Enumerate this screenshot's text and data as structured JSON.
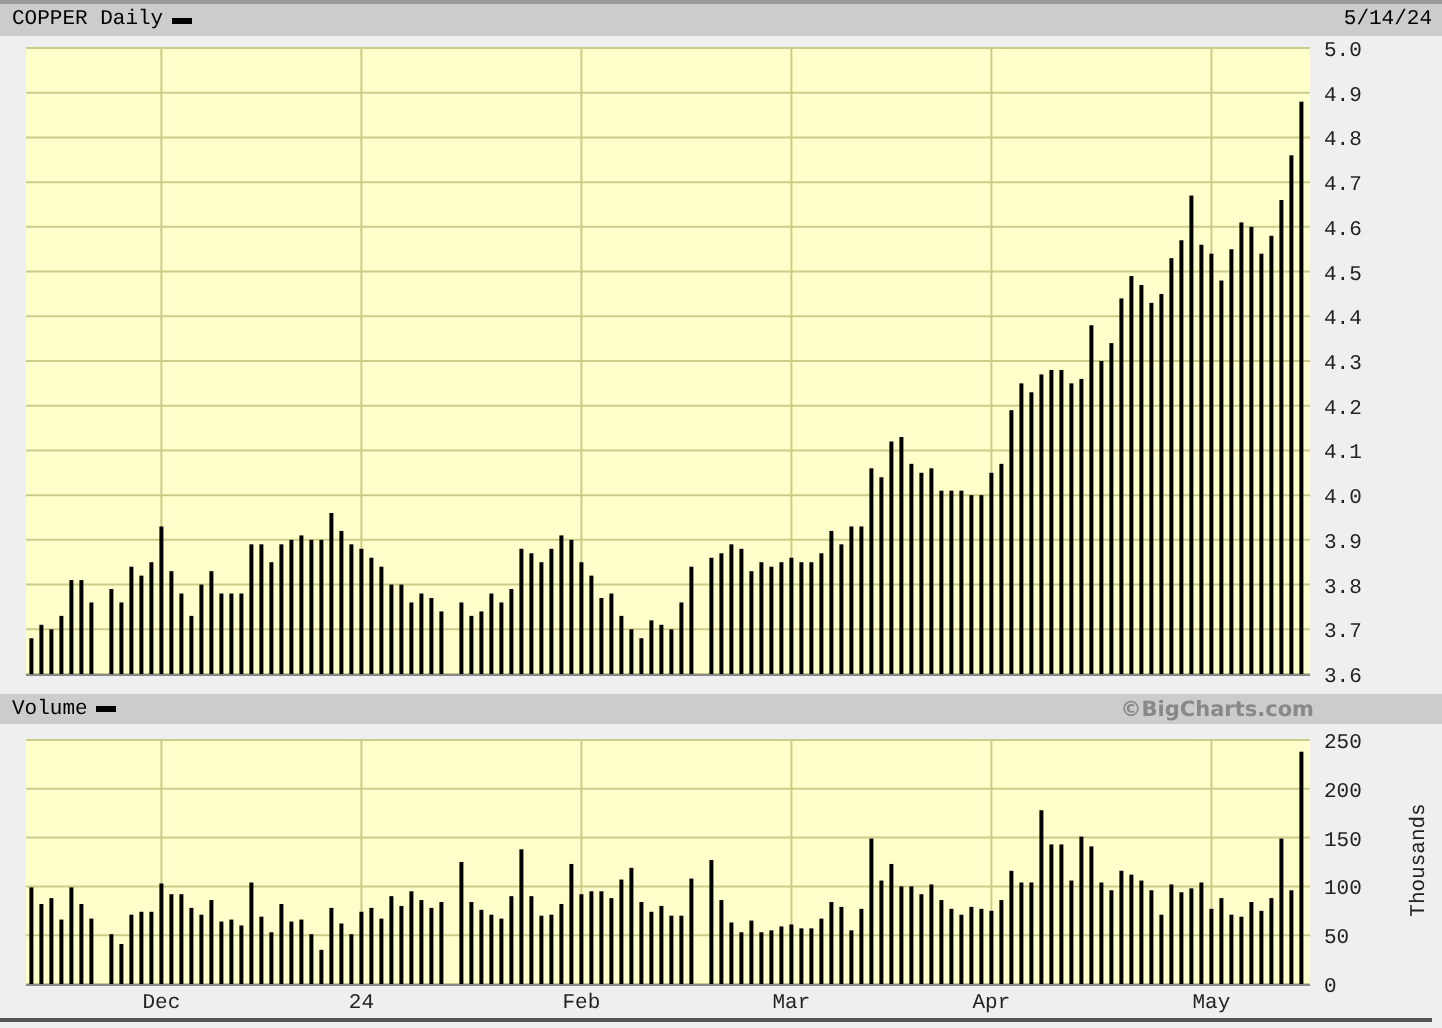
{
  "price_panel": {
    "title": "COPPER Daily",
    "date": "5/14/24",
    "chart_data": {
      "type": "bar",
      "grid": true,
      "ylim": [
        3.6,
        5.0
      ],
      "yticks": [
        {
          "value": 3.6,
          "label": "3.6"
        },
        {
          "value": 3.7,
          "label": "3.7"
        },
        {
          "value": 3.8,
          "label": "3.8"
        },
        {
          "value": 3.9,
          "label": "3.9"
        },
        {
          "value": 4.0,
          "label": "4.0"
        },
        {
          "value": 4.1,
          "label": "4.1"
        },
        {
          "value": 4.2,
          "label": "4.2"
        },
        {
          "value": 4.3,
          "label": "4.3"
        },
        {
          "value": 4.4,
          "label": "4.4"
        },
        {
          "value": 4.5,
          "label": "4.5"
        },
        {
          "value": 4.6,
          "label": "4.6"
        },
        {
          "value": 4.7,
          "label": "4.7"
        },
        {
          "value": 4.8,
          "label": "4.8"
        },
        {
          "value": 4.9,
          "label": "4.9"
        },
        {
          "value": 5.0,
          "label": "5.0"
        }
      ],
      "values": [
        3.68,
        3.71,
        3.7,
        3.73,
        3.81,
        3.81,
        3.76,
        null,
        3.79,
        3.76,
        3.84,
        3.82,
        3.85,
        3.93,
        3.83,
        3.78,
        3.73,
        3.8,
        3.83,
        3.78,
        3.78,
        3.78,
        3.89,
        3.89,
        3.85,
        3.89,
        3.9,
        3.91,
        3.9,
        3.9,
        3.96,
        3.92,
        3.89,
        3.88,
        3.86,
        3.84,
        3.8,
        3.8,
        3.76,
        3.78,
        3.77,
        3.74,
        null,
        3.76,
        3.73,
        3.74,
        3.78,
        3.76,
        3.79,
        3.88,
        3.87,
        3.85,
        3.88,
        3.91,
        3.9,
        3.85,
        3.82,
        3.77,
        3.78,
        3.73,
        3.7,
        3.68,
        3.72,
        3.71,
        3.7,
        3.76,
        3.84,
        null,
        3.86,
        3.87,
        3.89,
        3.88,
        3.83,
        3.85,
        3.84,
        3.85,
        3.86,
        3.85,
        3.85,
        3.87,
        3.92,
        3.89,
        3.93,
        3.93,
        4.06,
        4.04,
        4.12,
        4.13,
        4.07,
        4.05,
        4.06,
        4.01,
        4.01,
        4.01,
        4.0,
        4.0,
        4.05,
        4.07,
        4.19,
        4.25,
        4.23,
        4.27,
        4.28,
        4.28,
        4.25,
        4.26,
        4.38,
        4.3,
        4.34,
        4.44,
        4.49,
        4.47,
        4.43,
        4.45,
        4.53,
        4.57,
        4.67,
        4.56,
        4.54,
        4.48,
        4.55,
        4.61,
        4.6,
        4.54,
        4.58,
        4.66,
        4.76,
        4.88
      ]
    }
  },
  "volume_panel": {
    "title": "Volume",
    "credit": "©BigCharts.com",
    "chart_data": {
      "type": "bar",
      "grid": true,
      "ylabel": "Thousands",
      "ylim": [
        0,
        250
      ],
      "yticks": [
        0,
        50,
        100,
        150,
        200,
        250
      ],
      "categories": [
        null,
        null,
        null,
        null,
        null,
        null,
        null,
        null,
        null,
        null,
        null,
        null,
        null,
        "Dec",
        null,
        null,
        null,
        null,
        null,
        null,
        null,
        null,
        null,
        null,
        null,
        null,
        null,
        null,
        null,
        null,
        null,
        null,
        null,
        "24",
        null,
        null,
        null,
        null,
        null,
        null,
        null,
        null,
        null,
        null,
        null,
        null,
        null,
        null,
        null,
        null,
        null,
        null,
        null,
        null,
        null,
        "Feb",
        null,
        null,
        null,
        null,
        null,
        null,
        null,
        null,
        null,
        null,
        null,
        null,
        null,
        null,
        null,
        null,
        null,
        null,
        null,
        null,
        "Mar",
        null,
        null,
        null,
        null,
        null,
        null,
        null,
        null,
        null,
        null,
        null,
        null,
        null,
        null,
        null,
        null,
        null,
        null,
        null,
        "Apr",
        null,
        null,
        null,
        null,
        null,
        null,
        null,
        null,
        null,
        null,
        null,
        null,
        null,
        null,
        null,
        null,
        null,
        null,
        null,
        null,
        null,
        "May",
        null,
        null,
        null,
        null,
        null,
        null,
        null,
        null,
        null
      ],
      "values": [
        99,
        82,
        88,
        66,
        99,
        82,
        67,
        null,
        51,
        41,
        71,
        74,
        74,
        103,
        92,
        92,
        78,
        71,
        86,
        64,
        66,
        60,
        104,
        69,
        53,
        82,
        64,
        66,
        51,
        35,
        78,
        62,
        51,
        74,
        78,
        67,
        90,
        80,
        95,
        86,
        78,
        84,
        null,
        125,
        84,
        76,
        71,
        67,
        90,
        138,
        90,
        70,
        71,
        82,
        123,
        92,
        95,
        95,
        88,
        107,
        119,
        84,
        74,
        80,
        70,
        70,
        108,
        null,
        127,
        86,
        63,
        53,
        65,
        53,
        55,
        59,
        61,
        57,
        57,
        67,
        84,
        79,
        55,
        77,
        149,
        106,
        123,
        100,
        100,
        92,
        102,
        86,
        77,
        71,
        79,
        77,
        75,
        86,
        116,
        104,
        104,
        178,
        143,
        143,
        106,
        151,
        141,
        104,
        96,
        116,
        112,
        106,
        96,
        71,
        102,
        94,
        98,
        104,
        77,
        88,
        71,
        69,
        84,
        75,
        88,
        149,
        96,
        238
      ]
    }
  }
}
